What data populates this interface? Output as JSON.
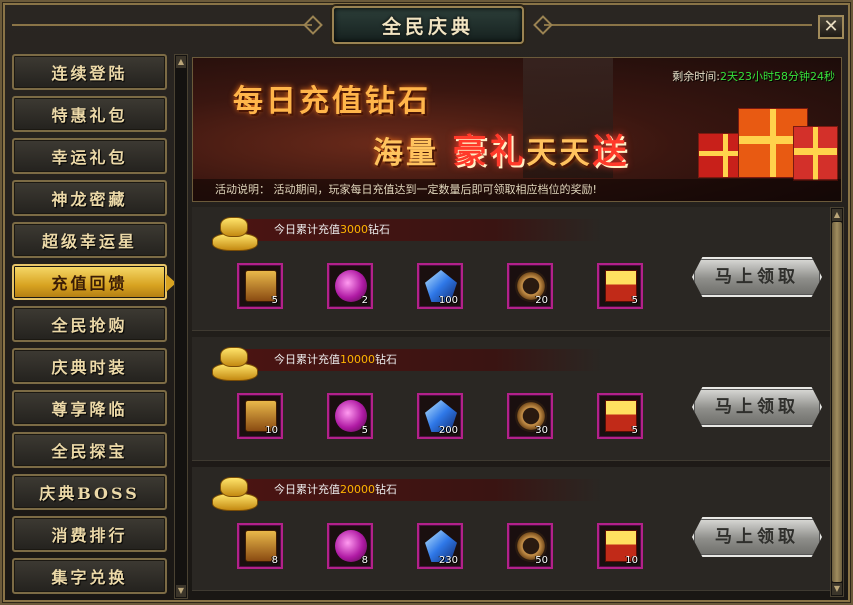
{
  "window": {
    "title": "全民庆典",
    "close_label": "✕"
  },
  "sidebar": {
    "items": [
      {
        "label": "连续登陆",
        "active": false
      },
      {
        "label": "特惠礼包",
        "active": false
      },
      {
        "label": "幸运礼包",
        "active": false
      },
      {
        "label": "神龙密藏",
        "active": false
      },
      {
        "label": "超级幸运星",
        "active": false
      },
      {
        "label": "充值回馈",
        "active": true
      },
      {
        "label": "全民抢购",
        "active": false
      },
      {
        "label": "庆典时装",
        "active": false
      },
      {
        "label": "尊享降临",
        "active": false
      },
      {
        "label": "全民探宝",
        "active": false
      },
      {
        "label": "庆典BOSS",
        "active": false
      },
      {
        "label": "消费排行",
        "active": false
      },
      {
        "label": "集字兑换",
        "active": false
      }
    ]
  },
  "banner": {
    "title_line1": "每日充值钻石",
    "title_line2_a": "海量",
    "title_line2_hot": "豪礼",
    "title_line2_b": "天天",
    "title_line2_hot2": "送",
    "timer_label": "剩余时间:",
    "timer_value": "2天23小时58分钟24秒",
    "desc_label": "活动说明：",
    "desc_text": "活动期间，玩家每日充值达到一定数量后即可领取相应档位的奖励!"
  },
  "tiers": [
    {
      "prefix": "今日累计充值",
      "amount": "3000",
      "suffix": "钻石",
      "claim_label": "马上领取",
      "items": [
        {
          "icon": "treasure-chest-icon",
          "count": "5"
        },
        {
          "icon": "purple-orb-icon",
          "count": "2"
        },
        {
          "icon": "blue-crystal-icon",
          "count": "100"
        },
        {
          "icon": "dragon-ring-icon",
          "count": "20"
        },
        {
          "icon": "gold-box-icon",
          "count": "5"
        }
      ]
    },
    {
      "prefix": "今日累计充值",
      "amount": "10000",
      "suffix": "钻石",
      "claim_label": "马上领取",
      "items": [
        {
          "icon": "treasure-chest-icon",
          "count": "10"
        },
        {
          "icon": "purple-orb-icon",
          "count": "5"
        },
        {
          "icon": "blue-crystal-icon",
          "count": "200"
        },
        {
          "icon": "dragon-ring-icon",
          "count": "30"
        },
        {
          "icon": "gold-box-icon",
          "count": "5"
        }
      ]
    },
    {
      "prefix": "今日累计充值",
      "amount": "20000",
      "suffix": "钻石",
      "claim_label": "马上领取",
      "items": [
        {
          "icon": "treasure-chest-icon",
          "count": "8"
        },
        {
          "icon": "purple-orb-icon",
          "count": "8"
        },
        {
          "icon": "blue-crystal-icon",
          "count": "230"
        },
        {
          "icon": "dragon-ring-icon",
          "count": "50"
        },
        {
          "icon": "gold-box-icon",
          "count": "10"
        }
      ]
    }
  ],
  "colors": {
    "accent_gold": "#d8a321",
    "amount": "#ffb400",
    "timer": "#37e03a",
    "item_border": "#b2218a"
  }
}
